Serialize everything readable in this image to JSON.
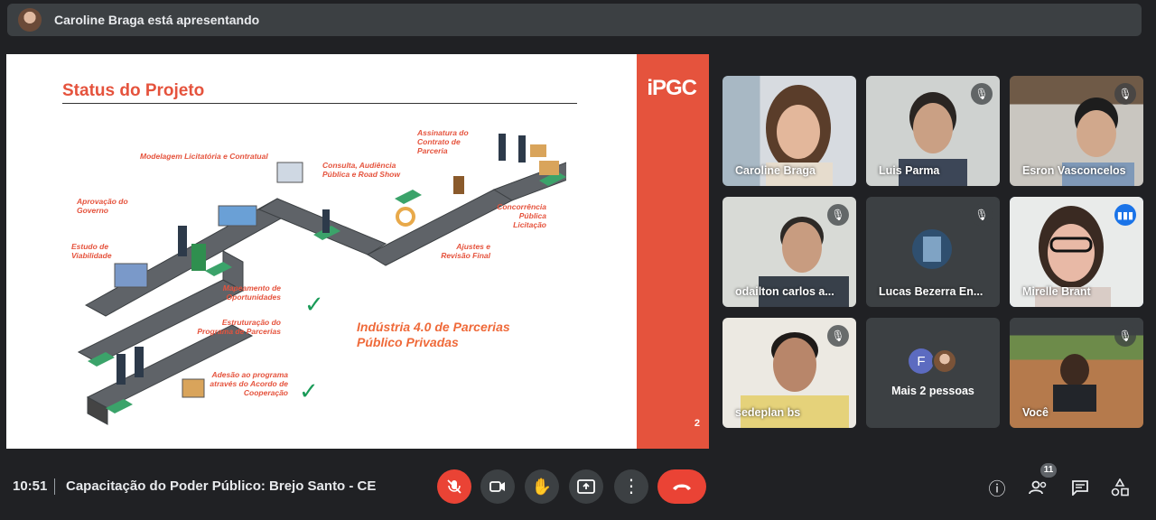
{
  "presenter_banner": {
    "text": "Caroline Braga está apresentando"
  },
  "slide": {
    "title": "Status do Projeto",
    "logo": "iPGC",
    "page_number": "2",
    "headline": "Indústria 4.0 de Parcerias Público Privadas",
    "labels": [
      "Modelagem Licitatória e Contratual",
      "Consulta, Audiência Pública e Road Show",
      "Assinatura do Contrato de Parceria",
      "Aprovação do Governo",
      "Concorrência Pública Licitação",
      "Estudo de Viabilidade",
      "Ajustes e Revisão Final",
      "Mapeamento de Oportunidades",
      "Estruturação do Programa de Parcerias",
      "Adesão ao programa através do Acordo de Cooperação"
    ]
  },
  "participants": [
    {
      "name": "Caroline Braga",
      "muted": false
    },
    {
      "name": "Luis Parma",
      "muted": true
    },
    {
      "name": "Esron Vasconcelos",
      "muted": true
    },
    {
      "name": "odailton carlos a...",
      "muted": true
    },
    {
      "name": "Lucas Bezerra En...",
      "muted": true
    },
    {
      "name": "Mirelle Brant",
      "muted": false
    },
    {
      "name": "sedeplan bs",
      "muted": true
    },
    {
      "name": "Mais 2 pessoas",
      "initial": "F"
    },
    {
      "name": "Você",
      "muted": true
    }
  ],
  "bottom_bar": {
    "time": "10:51",
    "meeting_title": "Capacitação do Poder Público: Brejo Santo - CE",
    "people_count": "11"
  },
  "colors": {
    "accent_red": "#e5533d",
    "speaking_blue": "#1a73e8",
    "check_green": "#1a9b58"
  }
}
